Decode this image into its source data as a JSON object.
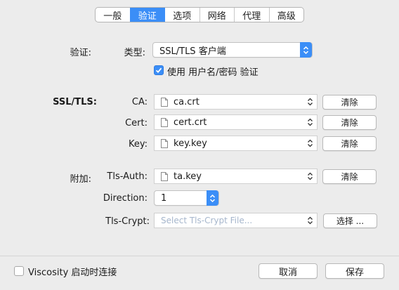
{
  "tabs": [
    "一般",
    "验证",
    "选项",
    "网络",
    "代理",
    "高级"
  ],
  "active_tab_index": 1,
  "auth": {
    "section_label": "验证:",
    "type_label": "类型:",
    "type_value": "SSL/TLS 客户端",
    "use_credentials_label": "使用 用户名/密码 验证",
    "use_credentials_checked": true
  },
  "ssl": {
    "section_label": "SSL/TLS:",
    "ca_label": "CA:",
    "ca_value": "ca.crt",
    "cert_label": "Cert:",
    "cert_value": "cert.crt",
    "key_label": "Key:",
    "key_value": "key.key",
    "clear_label": "清除"
  },
  "extra": {
    "section_label": "附加:",
    "tls_auth_label": "Tls-Auth:",
    "tls_auth_value": "ta.key",
    "clear_label": "清除",
    "direction_label": "Direction:",
    "direction_value": "1",
    "tls_crypt_label": "Tls-Crypt:",
    "tls_crypt_placeholder": "Select Tls-Crypt File...",
    "choose_label": "选择 ..."
  },
  "footer": {
    "startup_label": "Viscosity 启动时连接",
    "startup_checked": false,
    "cancel_label": "取消",
    "save_label": "保存"
  },
  "colors": {
    "accent": "#3b8ef7",
    "window_bg": "#ececec",
    "placeholder": "#a6b6cc"
  },
  "icons": [
    "chevron-updown-icon",
    "document-icon",
    "checkmark-icon"
  ]
}
